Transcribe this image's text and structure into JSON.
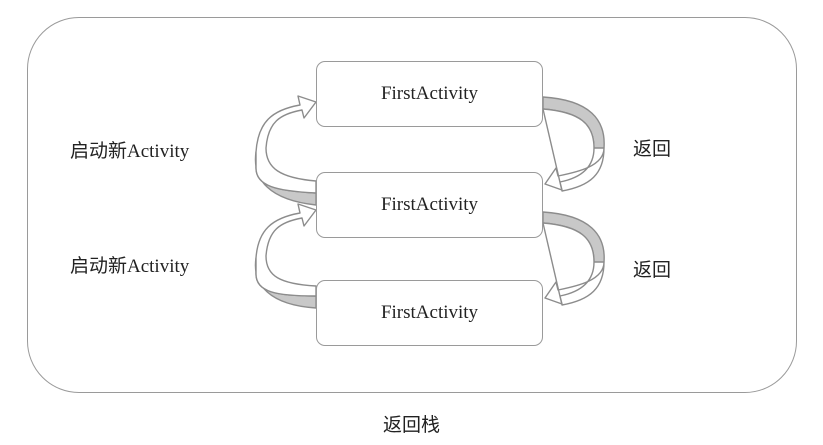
{
  "diagram": {
    "activities": [
      {
        "label": "FirstActivity"
      },
      {
        "label": "FirstActivity"
      },
      {
        "label": "FirstActivity"
      }
    ],
    "launch_labels": [
      "启动新Activity",
      "启动新Activity"
    ],
    "back_labels": [
      "返回",
      "返回"
    ],
    "stack_caption": "返回栈"
  },
  "colors": {
    "border": "#9a9a9a",
    "arrow_shade": "#c8c8c8",
    "text": "#222222"
  },
  "icons": [
    "curved-launch-arrow-icon",
    "curved-back-arrow-icon"
  ]
}
